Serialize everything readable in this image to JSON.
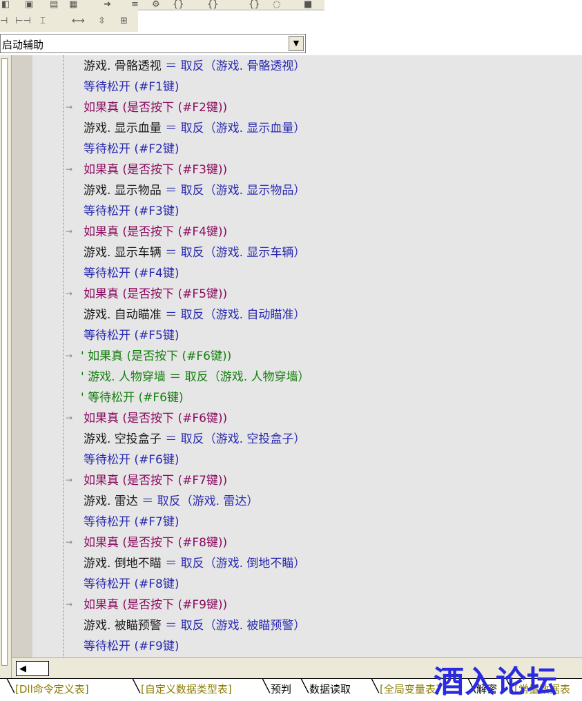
{
  "combo": {
    "value": "启动辅助"
  },
  "code_lines": [
    {
      "type": "assign",
      "lhs": "游戏. 骨骼透视",
      "rhs": "取反（游戏. 骨骼透视）"
    },
    {
      "type": "call",
      "text": "等待松开 (#F1键)"
    },
    {
      "type": "if",
      "text": "如果真 (是否按下 (#F2键))"
    },
    {
      "type": "assign",
      "lhs": "游戏. 显示血量",
      "rhs": "取反（游戏. 显示血量）"
    },
    {
      "type": "call",
      "text": "等待松开 (#F2键)"
    },
    {
      "type": "if",
      "text": "如果真 (是否按下 (#F3键))"
    },
    {
      "type": "assign",
      "lhs": "游戏. 显示物品",
      "rhs": "取反（游戏. 显示物品）"
    },
    {
      "type": "call",
      "text": "等待松开 (#F3键)"
    },
    {
      "type": "if",
      "text": "如果真 (是否按下 (#F4键))"
    },
    {
      "type": "assign",
      "lhs": "游戏. 显示车辆",
      "rhs": "取反（游戏. 显示车辆）"
    },
    {
      "type": "call",
      "text": "等待松开 (#F4键)"
    },
    {
      "type": "if",
      "text": "如果真 (是否按下 (#F5键))"
    },
    {
      "type": "assign",
      "lhs": "游戏. 自动瞄准",
      "rhs": "取反（游戏. 自动瞄准）"
    },
    {
      "type": "call",
      "text": "等待松开 (#F5键)"
    },
    {
      "type": "comment-if",
      "text": "' 如果真 (是否按下 (#F6键))"
    },
    {
      "type": "comment",
      "text": "' 游戏. 人物穿墙 ＝ 取反（游戏. 人物穿墙）"
    },
    {
      "type": "comment",
      "text": "' 等待松开 (#F6键)"
    },
    {
      "type": "if",
      "text": "如果真 (是否按下 (#F6键))"
    },
    {
      "type": "assign",
      "lhs": "游戏. 空投盒子",
      "rhs": "取反（游戏. 空投盒子）"
    },
    {
      "type": "call",
      "text": "等待松开 (#F6键)"
    },
    {
      "type": "if",
      "text": "如果真 (是否按下 (#F7键))"
    },
    {
      "type": "assign",
      "lhs": "游戏. 雷达",
      "rhs": "取反（游戏. 雷达）"
    },
    {
      "type": "call",
      "text": "等待松开 (#F7键)"
    },
    {
      "type": "if",
      "text": "如果真 (是否按下 (#F8键))"
    },
    {
      "type": "assign",
      "lhs": "游戏. 倒地不瞄",
      "rhs": "取反（游戏. 倒地不瞄）"
    },
    {
      "type": "call",
      "text": "等待松开 (#F8键)"
    },
    {
      "type": "if",
      "text": "如果真 (是否按下 (#F9键))"
    },
    {
      "type": "assign",
      "lhs": "游戏. 被瞄预警",
      "rhs": "取反（游戏. 被瞄预警）"
    },
    {
      "type": "call",
      "text": "等待松开 (#F9键)"
    }
  ],
  "tabs": [
    {
      "label": "[Dll命令定义表]",
      "style": "y"
    },
    {
      "label": "[自定义数据类型表]",
      "style": "y"
    },
    {
      "label": "预判",
      "style": "k"
    },
    {
      "label": "数据读取",
      "style": "k"
    },
    {
      "label": "[全局变量表]",
      "style": "y"
    },
    {
      "label": "解密",
      "style": "k"
    },
    {
      "label": "[常量数据表",
      "style": "y"
    }
  ],
  "watermark": "酒入论坛",
  "colors": {
    "keyword": "#8b0a60",
    "call": "#2a2ab0",
    "comment": "#15800f",
    "code_bg": "#e6e6e6",
    "watermark": "#2a2ae0"
  },
  "icons": [
    "toolbar-icons",
    "combo-dropdown-arrow-icon",
    "scroll-left-arrow-icon",
    "flow-arrow-icon"
  ]
}
